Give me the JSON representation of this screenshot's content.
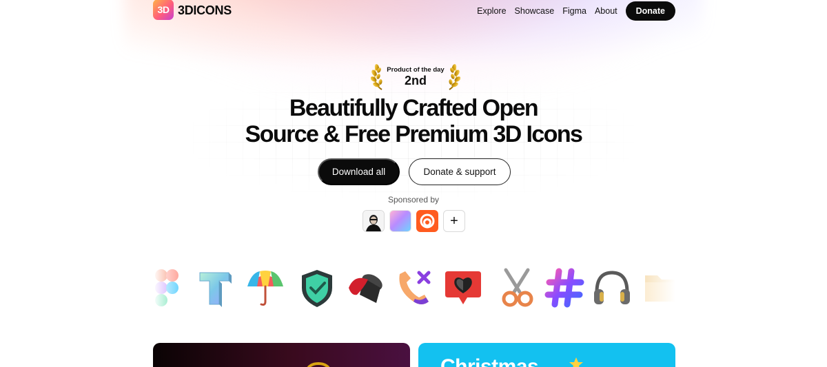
{
  "brand": {
    "logo_mark": "3D",
    "name": "3DICONS"
  },
  "nav": {
    "links": [
      "Explore",
      "Showcase",
      "Figma",
      "About"
    ],
    "donate_label": "Donate"
  },
  "award": {
    "label": "Product of the day",
    "rank": "2nd",
    "icon": "laurel-icon"
  },
  "hero": {
    "headline_line1": "Beautifully Crafted Open",
    "headline_line2": "Source & Free Premium 3D Icons"
  },
  "cta": {
    "primary_label": "Download all",
    "secondary_label": "Donate & support"
  },
  "sponsors": {
    "label": "Sponsored by",
    "items": [
      "sponsor-person-avatar",
      "sponsor-gradient-logo",
      "sponsor-orange-logo"
    ],
    "add_symbol": "+"
  },
  "icon_strip": [
    "figma-icon",
    "text-t-icon",
    "umbrella-icon",
    "shield-check-icon",
    "paint-bucket-icon",
    "phone-call-icon",
    "heart-notification-icon",
    "scissors-icon",
    "hashtag-icon",
    "headphones-icon",
    "folder-icon"
  ],
  "cards": {
    "blue_title": "Christmas"
  },
  "colors": {
    "ink": "#0b0b0b",
    "accent_blue": "#13c1f0",
    "orange": "#ff5b1f"
  }
}
